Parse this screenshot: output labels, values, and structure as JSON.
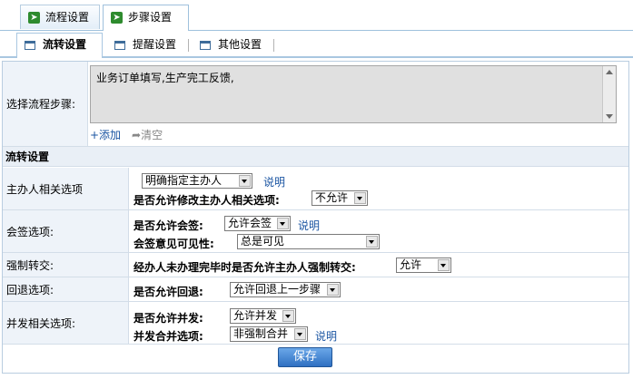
{
  "top_tabs": [
    {
      "label": "流程设置",
      "icon": "green-arrow-icon"
    },
    {
      "label": "步骤设置",
      "icon": "green-arrow-icon"
    }
  ],
  "sub_tabs": [
    {
      "label": "流转设置",
      "icon": "document-icon"
    },
    {
      "label": "提醒设置",
      "icon": "document-icon"
    },
    {
      "label": "其他设置",
      "icon": "document-icon"
    }
  ],
  "step_select": {
    "label": "选择流程步骤:",
    "value": "业务订单填写,生产完工反馈,",
    "add_label": "+添加",
    "clear_label": "清空"
  },
  "section_title": "流转设置",
  "host": {
    "label": "主办人相关选项",
    "select_value": "明确指定主办人",
    "help": "说明",
    "modify_label": "是否允许修改主办人相关选项:",
    "modify_value": "不允许"
  },
  "countersign": {
    "label": "会签选项:",
    "allow_label": "是否允许会签:",
    "allow_value": "允许会签",
    "help": "说明",
    "visible_label": "会签意见可见性:",
    "visible_value": "总是可见"
  },
  "force": {
    "label": "强制转交:",
    "question": "经办人未办理完毕时是否允许主办人强制转交:",
    "value": "允许"
  },
  "rollback": {
    "label": "回退选项:",
    "allow_label": "是否允许回退:",
    "value": "允许回退上一步骤"
  },
  "concurrent": {
    "label": "并发相关选项:",
    "allow_label": "是否允许并发:",
    "allow_value": "允许并发",
    "merge_label": "并发合并选项:",
    "merge_value": "非强制合并",
    "help": "说明"
  },
  "save_label": "保存"
}
